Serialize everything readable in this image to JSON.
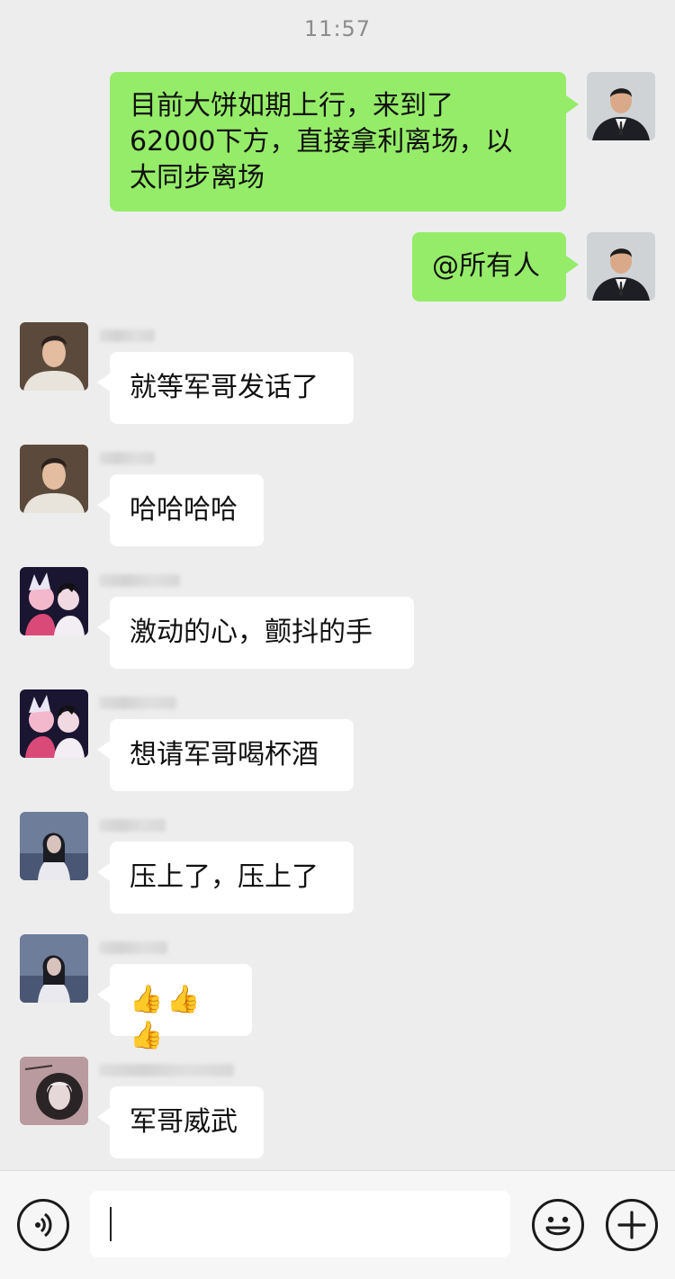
{
  "status": {
    "time": "11:57"
  },
  "messages": [
    {
      "sender": "me",
      "avatar": "man-in-suit-avatar",
      "text": "目前大饼如期上行，来到了\n62000下方，直接拿利离场，以\n太同步离场"
    },
    {
      "sender": "me",
      "avatar": "man-in-suit-avatar",
      "text": "@所有人"
    },
    {
      "sender": "other",
      "avatar": "young-man-avatar",
      "nickname_blurred": true,
      "text": "就等军哥发话了"
    },
    {
      "sender": "other",
      "avatar": "young-man-avatar",
      "nickname_blurred": true,
      "text": "哈哈哈哈"
    },
    {
      "sender": "other",
      "avatar": "anime-pair-avatar",
      "nickname_blurred": true,
      "text": "激动的心，颤抖的手"
    },
    {
      "sender": "other",
      "avatar": "anime-pair-avatar",
      "nickname_blurred": true,
      "text": "想请军哥喝杯酒"
    },
    {
      "sender": "other",
      "avatar": "girl-night-avatar",
      "nickname_blurred": true,
      "text": "压上了，压上了"
    },
    {
      "sender": "other",
      "avatar": "girl-night-avatar",
      "nickname_blurred": true,
      "text": "👍👍👍"
    },
    {
      "sender": "other",
      "avatar": "sketch-portrait-avatar",
      "nickname_blurred": true,
      "text": "军哥威武"
    }
  ],
  "input_bar": {
    "voice_icon": "voice-icon",
    "emoji_icon": "emoji-icon",
    "plus_icon": "plus-icon",
    "text_value": ""
  },
  "colors": {
    "background": "#ededed",
    "my_bubble": "#95ec69",
    "other_bubble": "#ffffff"
  }
}
